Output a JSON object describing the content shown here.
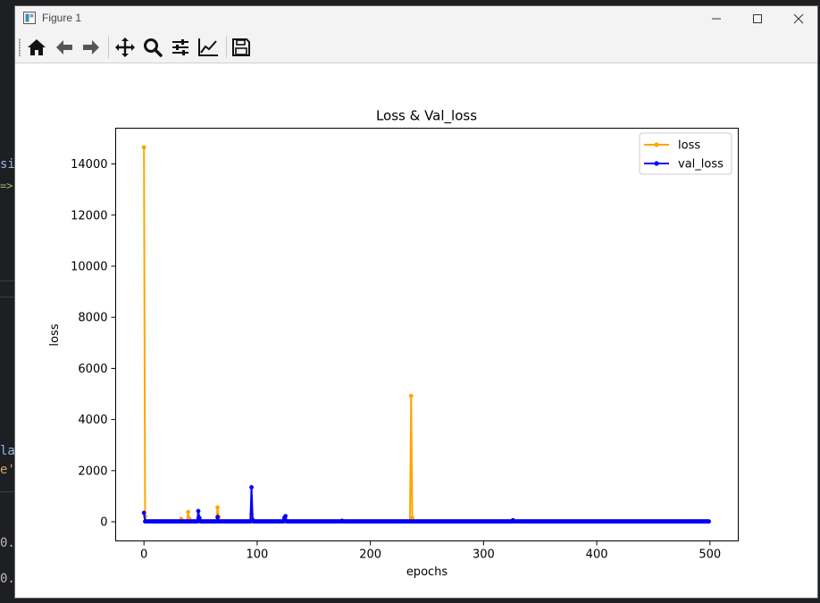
{
  "window": {
    "title": "Figure 1",
    "controls": [
      "minimize",
      "maximize",
      "close"
    ]
  },
  "toolbar": {
    "buttons": [
      {
        "name": "home-icon",
        "tooltip": "Reset original view"
      },
      {
        "name": "back-icon",
        "tooltip": "Back"
      },
      {
        "name": "forward-icon",
        "tooltip": "Forward"
      },
      {
        "name": "pan-icon",
        "tooltip": "Pan"
      },
      {
        "name": "zoom-icon",
        "tooltip": "Zoom"
      },
      {
        "name": "subplots-icon",
        "tooltip": "Configure subplots"
      },
      {
        "name": "axes-icon",
        "tooltip": "Edit axis"
      },
      {
        "name": "save-icon",
        "tooltip": "Save"
      }
    ]
  },
  "background": {
    "fragments": [
      "si",
      "=>",
      "la",
      "e'",
      "0.",
      "0."
    ],
    "colors": [
      "#8fb8e8",
      "#9bbf6a",
      "#8fb8e8",
      "#d7a26a",
      "#bbbbbb",
      "#bbbbbb"
    ]
  },
  "chart_data": {
    "type": "line",
    "title": "Loss & Val_loss",
    "xlabel": "epochs",
    "ylabel": "loss",
    "xlim": [
      -25,
      525
    ],
    "ylim": [
      -750,
      15400
    ],
    "xticks": [
      0,
      100,
      200,
      300,
      400,
      500
    ],
    "yticks": [
      0,
      2000,
      4000,
      6000,
      8000,
      10000,
      12000,
      14000
    ],
    "legend_position": "upper right",
    "series": [
      {
        "name": "loss",
        "color": "#ffa500",
        "baseline": 15,
        "n_points": 500,
        "spikes": [
          [
            0,
            14650
          ],
          [
            1,
            200
          ],
          [
            33,
            110
          ],
          [
            39,
            380
          ],
          [
            40,
            120
          ],
          [
            48,
            150
          ],
          [
            65,
            560
          ],
          [
            66,
            200
          ],
          [
            95,
            300
          ],
          [
            125,
            80
          ],
          [
            236,
            4920
          ],
          [
            237,
            150
          ]
        ]
      },
      {
        "name": "val_loss",
        "color": "#0000ff",
        "baseline": 12,
        "n_points": 500,
        "spikes": [
          [
            0,
            350
          ],
          [
            48,
            420
          ],
          [
            49,
            150
          ],
          [
            65,
            180
          ],
          [
            95,
            1350
          ],
          [
            96,
            80
          ],
          [
            124,
            150
          ],
          [
            125,
            220
          ],
          [
            175,
            40
          ],
          [
            326,
            60
          ]
        ]
      }
    ]
  }
}
